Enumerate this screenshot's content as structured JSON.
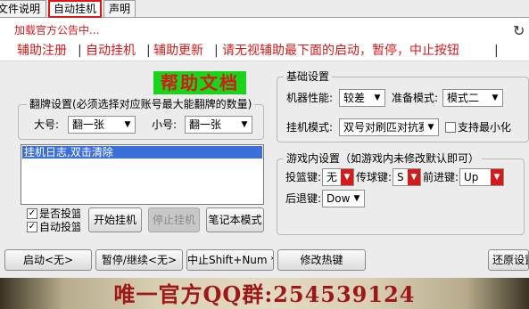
{
  "tabs": [
    {
      "label": "文件说明"
    },
    {
      "label": "自动挂机"
    },
    {
      "label": "声明"
    }
  ],
  "notice": "加载官方公告中...",
  "nav": {
    "register": "辅助注册",
    "autohang": "自动挂机",
    "update": "辅助更新",
    "hint": "请无视辅助最下面的启动，暂停，中止按钮"
  },
  "help_label": "帮助文档",
  "flip": {
    "title": "翻牌设置(必须选择对应账号最大能翻牌的数量)",
    "big_label": "大号:",
    "big_value": "翻一张",
    "small_label": "小号:",
    "small_value": "翻一张"
  },
  "basic": {
    "title": "基础设置",
    "perf_label": "机器性能:",
    "perf_value": "较差",
    "prep_label": "准备模式:",
    "prep_value": "模式二",
    "hang_label": "挂机模式:",
    "hang_value": "双号对刷匹对抗赛",
    "minimize_label": "支持最小化"
  },
  "log": {
    "first_line": "挂机日志,双击清除"
  },
  "checks": {
    "vote": "是否投篮",
    "autovote": "自动投篮"
  },
  "buttons": {
    "start_hang": "开始挂机",
    "stop_hang": "停止挂机",
    "laptop_mode": "笔记本模式",
    "start": "启动<无>",
    "pause": "暂停/继续<无>",
    "stop": "中止Shift+Num *",
    "hotkey": "修改热键",
    "restore": "还原设置"
  },
  "ingame": {
    "title": "游戏内设置（如游戏内未修改默认即可）",
    "shoot_label": "投篮键:",
    "shoot_value": "无",
    "pass_label": "传球键:",
    "pass_value": "S",
    "forward_label": "前进键:",
    "forward_value": "Up",
    "back_label": "后退键:",
    "back_value": "Down"
  },
  "footer": {
    "qq": "唯一官方QQ群:254539124"
  },
  "colors": {
    "accent_red": "#d41a1a",
    "help_green": "#19d419",
    "selection_blue": "#3d6fdb",
    "panel_gray": "#ececec"
  },
  "icons": {
    "refresh": "refresh-icon",
    "dropdown": "chevron-down-icon"
  }
}
